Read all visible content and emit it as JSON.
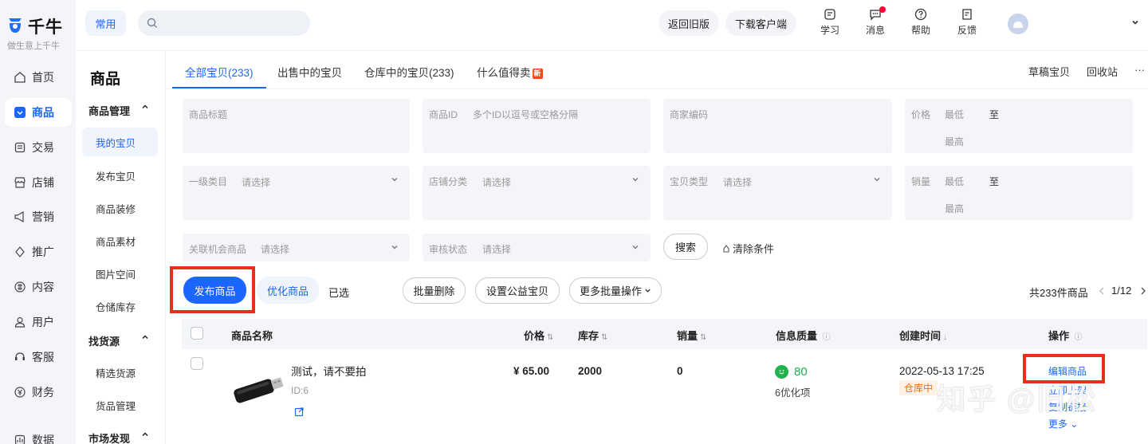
{
  "brand": {
    "name": "千牛",
    "slogan": "做生意上千牛"
  },
  "rail": [
    {
      "label": "首页",
      "icon": "home-icon"
    },
    {
      "label": "商品",
      "icon": "goods-icon",
      "active": true
    },
    {
      "label": "交易",
      "icon": "trade-icon"
    },
    {
      "label": "店铺",
      "icon": "shop-icon"
    },
    {
      "label": "营销",
      "icon": "marketing-icon"
    },
    {
      "label": "推广",
      "icon": "promote-icon"
    },
    {
      "label": "内容",
      "icon": "content-icon"
    },
    {
      "label": "用户",
      "icon": "user-icon"
    },
    {
      "label": "客服",
      "icon": "service-icon"
    },
    {
      "label": "财务",
      "icon": "finance-icon"
    },
    {
      "label": "数据",
      "icon": "data-icon"
    }
  ],
  "topbar": {
    "common": "常用",
    "search_placeholder": "",
    "old_version": "返回旧版",
    "download_client": "下载客户端",
    "tools": [
      {
        "label": "学习",
        "icon": "learn-icon"
      },
      {
        "label": "消息",
        "icon": "message-icon"
      },
      {
        "label": "帮助",
        "icon": "help-icon"
      },
      {
        "label": "反馈",
        "icon": "feedback-icon"
      }
    ]
  },
  "subnav": {
    "title": "商品",
    "group1": "商品管理",
    "items1": [
      "我的宝贝",
      "发布宝贝",
      "商品装修",
      "商品素材",
      "图片空间",
      "仓储库存"
    ],
    "group2": "找货源",
    "items2": [
      "精选货源",
      "货品管理"
    ],
    "group3": "市场发现"
  },
  "tabs": [
    {
      "label": "全部宝贝(233)",
      "active": true
    },
    {
      "label": "出售中的宝贝"
    },
    {
      "label": "仓库中的宝贝(233)"
    },
    {
      "label": "什么值得卖",
      "badge": "新"
    }
  ],
  "tabs_right": [
    "草稿宝贝",
    "回收站",
    "···"
  ],
  "filters": {
    "title": "商品标题",
    "id_label": "商品ID",
    "id_placeholder": "多个ID以逗号或空格分隔",
    "merchant_code": "商家编码",
    "price_label": "价格",
    "min": "最低",
    "to": "至",
    "max": "最高",
    "cat1_label": "一级类目",
    "select": "请选择",
    "shop_cat": "店铺分类",
    "item_type": "宝贝类型",
    "sales_label": "销量",
    "related_label": "关联机会商品",
    "audit_label": "审核状态",
    "search_btn": "搜索",
    "clear_btn": "清除条件"
  },
  "actions": {
    "publish": "发布商品",
    "optimize": "优化商品",
    "selected": "已选",
    "batch_delete": "批量删除",
    "set_charity": "设置公益宝贝",
    "more_batch": "更多批量操作"
  },
  "pager": {
    "total": "共233件商品",
    "page": "1/12"
  },
  "table": {
    "headers": [
      "商品名称",
      "价格",
      "库存",
      "销量",
      "信息质量",
      "创建时间",
      "操作"
    ],
    "rows": [
      {
        "name": "测试，请不要拍",
        "id": "ID:6",
        "price": "¥ 65.00",
        "stock": "2000",
        "sales": "0",
        "quality": "80",
        "quality_tip": "6优化项",
        "created": "2022-05-13 17:25",
        "status": "仓库中",
        "ops": [
          "编辑商品",
          "立即上架",
          "复制链接",
          "更多"
        ]
      }
    ]
  },
  "watermark": "知乎 @旧松",
  "colors": {
    "accent": "#1a66ff",
    "highlight": "#e5301a",
    "success": "#1fb34d",
    "warehouse": "#ff6a00"
  }
}
